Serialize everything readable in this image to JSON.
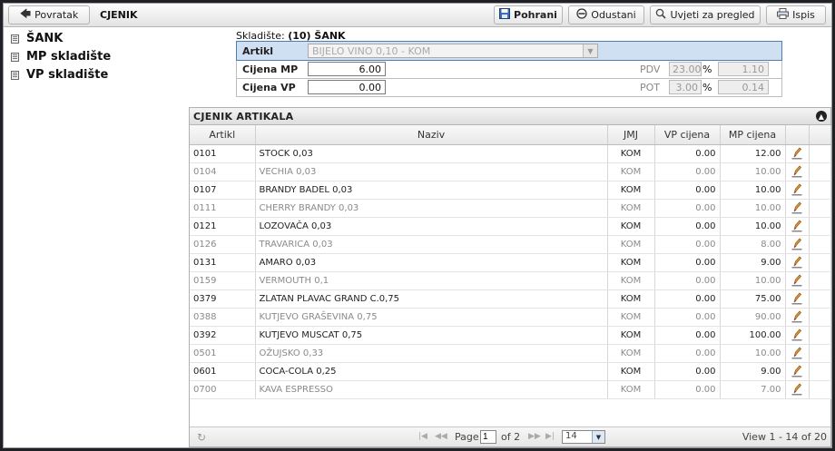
{
  "toolbar": {
    "back_label": "Povratak",
    "title": "CJENIK",
    "save_label": "Pohrani",
    "cancel_label": "Odustani",
    "filter_label": "Uvjeti za pregled",
    "print_label": "Ispis"
  },
  "sidebar": {
    "items": [
      {
        "label": "ŠANK"
      },
      {
        "label": "MP skladište"
      },
      {
        "label": "VP skladište"
      }
    ]
  },
  "form": {
    "warehouse_prefix": "Skladište:",
    "warehouse_value": "(10) ŠANK",
    "artikl_label": "Artikl",
    "artikl_value": "BIJELO VINO 0,10 - KOM",
    "mp_label": "Cijena MP",
    "mp_value": "6.00",
    "vp_label": "Cijena VP",
    "vp_value": "0.00",
    "pdv_label": "PDV",
    "pdv_rate": "23.00",
    "pdv_amount": "1.10",
    "pot_label": "POT",
    "pot_rate": "3.00",
    "pot_amount": "0.14",
    "percent": "%"
  },
  "grid": {
    "caption": "CJENIK ARTIKALA",
    "headers": {
      "artikl": "Artikl",
      "naziv": "Naziv",
      "jmj": "JMJ",
      "vp": "VP cijena",
      "mp": "MP cijena"
    },
    "rows": [
      {
        "artikl": "0101",
        "naziv": "STOCK 0,03",
        "jmj": "KOM",
        "vp": "0.00",
        "mp": "12.00"
      },
      {
        "artikl": "0104",
        "naziv": "VECHIA 0,03",
        "jmj": "KOM",
        "vp": "0.00",
        "mp": "10.00"
      },
      {
        "artikl": "0107",
        "naziv": "BRANDY BADEL 0,03",
        "jmj": "KOM",
        "vp": "0.00",
        "mp": "10.00"
      },
      {
        "artikl": "0111",
        "naziv": "CHERRY BRANDY 0,03",
        "jmj": "KOM",
        "vp": "0.00",
        "mp": "10.00"
      },
      {
        "artikl": "0121",
        "naziv": "LOZOVAČA 0,03",
        "jmj": "KOM",
        "vp": "0.00",
        "mp": "10.00"
      },
      {
        "artikl": "0126",
        "naziv": "TRAVARICA 0,03",
        "jmj": "KOM",
        "vp": "0.00",
        "mp": "8.00"
      },
      {
        "artikl": "0131",
        "naziv": "AMARO 0,03",
        "jmj": "KOM",
        "vp": "0.00",
        "mp": "9.00"
      },
      {
        "artikl": "0159",
        "naziv": "VERMOUTH 0,1",
        "jmj": "KOM",
        "vp": "0.00",
        "mp": "10.00"
      },
      {
        "artikl": "0379",
        "naziv": "ZLATAN PLAVAC GRAND C.0,75",
        "jmj": "KOM",
        "vp": "0.00",
        "mp": "75.00"
      },
      {
        "artikl": "0388",
        "naziv": "KUTJEVO GRAŠEVINA 0,75",
        "jmj": "KOM",
        "vp": "0.00",
        "mp": "90.00"
      },
      {
        "artikl": "0392",
        "naziv": "KUTJEVO MUSCAT 0,75",
        "jmj": "KOM",
        "vp": "0.00",
        "mp": "100.00"
      },
      {
        "artikl": "0501",
        "naziv": "OŽUJSKO 0,33",
        "jmj": "KOM",
        "vp": "0.00",
        "mp": "10.00"
      },
      {
        "artikl": "0601",
        "naziv": "COCA-COLA 0,25",
        "jmj": "KOM",
        "vp": "0.00",
        "mp": "9.00"
      },
      {
        "artikl": "0700",
        "naziv": "KAVA ESPRESSO",
        "jmj": "KOM",
        "vp": "0.00",
        "mp": "7.00"
      }
    ]
  },
  "pager": {
    "page_label": "Page",
    "page_value": "1",
    "of_label": "of 2",
    "rows_per_page": "14",
    "view_text": "View 1 - 14 of 20"
  },
  "icons": {
    "back": "arrow-left-icon",
    "save": "floppy-disk-icon",
    "cancel": "circle-minus-icon",
    "filter": "magnifier-icon",
    "print": "printer-icon",
    "edit": "pencil-edit-icon"
  }
}
